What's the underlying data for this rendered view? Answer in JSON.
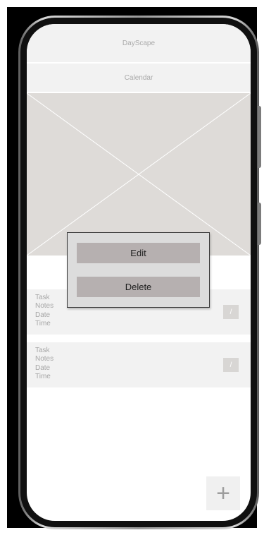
{
  "header": {
    "app_title": "DayScape"
  },
  "nav": {
    "calendar_label": "Calendar"
  },
  "tasks": [
    {
      "task": "Task",
      "notes": "Notes",
      "date": "Date",
      "time": "Time",
      "edit_glyph": "/"
    },
    {
      "task": "Task",
      "notes": "Notes",
      "date": "Date",
      "time": "Time",
      "edit_glyph": "/"
    }
  ],
  "fab": {
    "glyph": "+",
    "icon": "plus-icon"
  },
  "context_menu": {
    "edit_label": "Edit",
    "delete_label": "Delete"
  },
  "colors": {
    "background": "#000000",
    "screen": "#ffffff",
    "bar": "#f2f2f2",
    "placeholder": "#dedbd8",
    "popup": "#dcdcdc",
    "popup_button": "#b6b0b0"
  }
}
